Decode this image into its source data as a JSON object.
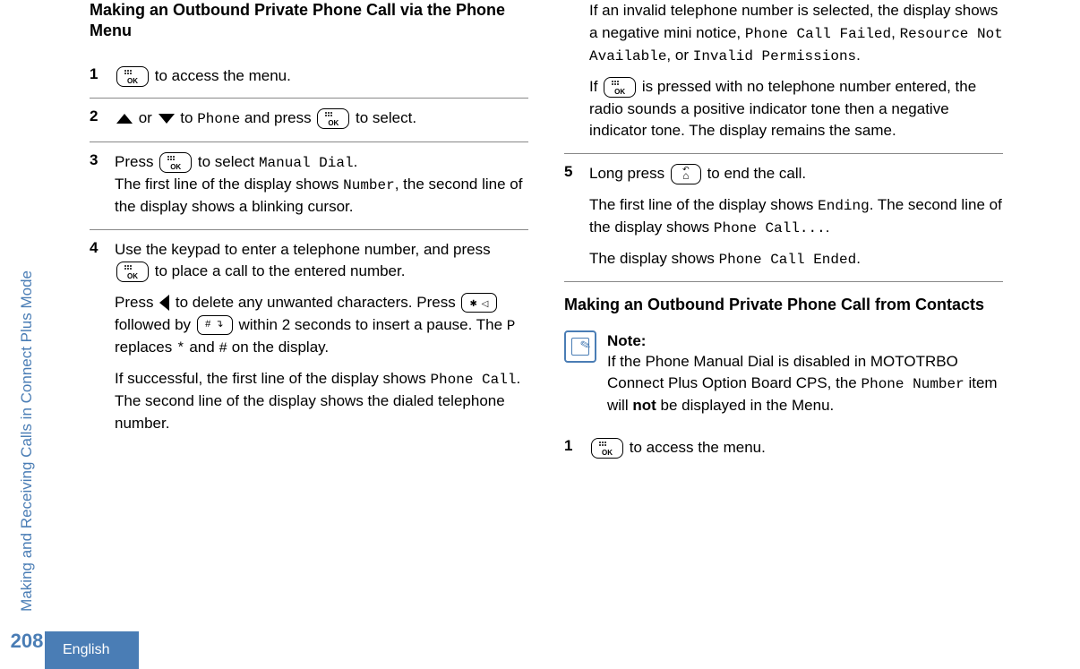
{
  "side_label": "Making and Receiving Calls in Connect Plus Mode",
  "page_number": "208",
  "language": "English",
  "left": {
    "title": "Making an Outbound Private Phone Call via the Phone Menu",
    "steps": {
      "s1": {
        "num": "1",
        "text_after_icon": " to access the menu."
      },
      "s2": {
        "num": "2",
        "t1": " or ",
        "t2": " to ",
        "phone": "Phone",
        "t3": " and press ",
        "t4": " to select."
      },
      "s3": {
        "num": "3",
        "t1": "Press ",
        "t2": " to select ",
        "manual": "Manual Dial",
        "t3": ".",
        "line2a": "The first line of the display shows ",
        "number_label": "Number",
        "line2b": ", the second line of the display shows a blinking cursor."
      },
      "s4": {
        "num": "4",
        "p1a": "Use the keypad to enter a telephone number, and press ",
        "p1b": " to place a call to the entered number.",
        "p2a": "Press ",
        "p2b": " to delete any unwanted characters. Press ",
        "p2c": " followed by ",
        "p2d": " within 2 seconds to insert a pause. The ",
        "P": "P",
        "p2e": " replaces ",
        "star": "*",
        "p2f": " and ",
        "hash": "#",
        "p2g": " on the display.",
        "p3a": "If successful, the first line of the display shows ",
        "phone_call": "Phone Call",
        "p3b": ". The second line of the display shows the dialed telephone number."
      }
    }
  },
  "right": {
    "cont": {
      "p1a": "If an invalid telephone number is selected, the display shows a negative mini notice, ",
      "pc_failed": "Phone Call Failed",
      "p1b": ", ",
      "rna": "Resource Not Available",
      "p1c": ", or ",
      "inv": "Invalid Permissions",
      "p1d": ".",
      "p2a": "If ",
      "p2b": " is pressed with no telephone number entered, the radio sounds a positive indicator tone then a negative indicator tone. The display remains the same."
    },
    "step5": {
      "num": "5",
      "t1": "Long press ",
      "t2": " to end the call.",
      "p2a": "The first line of the display shows ",
      "ending": "Ending",
      "p2b": ". The second line of the display shows ",
      "pc_dots": "Phone Call...",
      "p2c": ".",
      "p3a": "The display shows ",
      "pc_ended": "Phone Call Ended",
      "p3b": "."
    },
    "title2": "Making an Outbound Private Phone Call from Contacts",
    "note": {
      "title": "Note:",
      "t1": "If the Phone Manual Dial is disabled in MOTOTRBO Connect Plus Option Board CPS, the ",
      "pn": "Phone Number",
      "t2": " item will ",
      "not": "not",
      "t3": " be displayed in the Menu."
    },
    "step1b": {
      "num": "1",
      "text": " to access the menu."
    }
  }
}
